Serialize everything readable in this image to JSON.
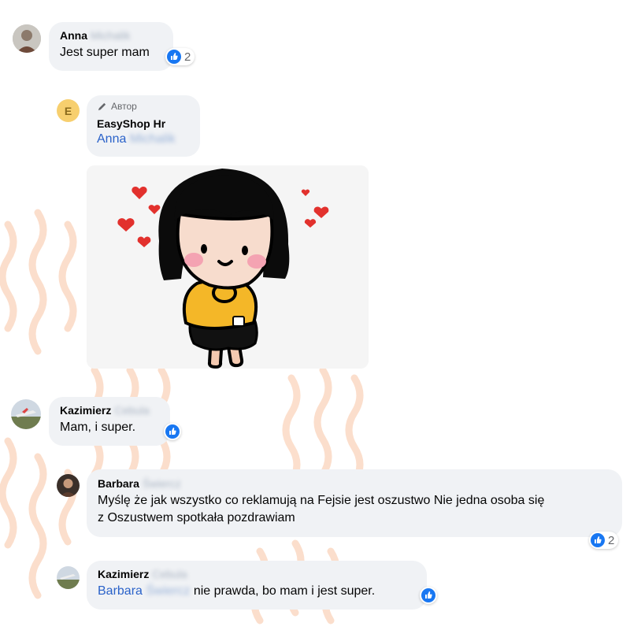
{
  "comments": [
    {
      "author_first": "Anna",
      "author_last_blurred": "Michalik",
      "text": "Jest super mam",
      "reaction_count": "2"
    },
    {
      "author_badge": "Автор",
      "avatar_letter": "E",
      "author": "EasyShop Hr",
      "mention_first": "Anna",
      "mention_last_blurred": "Michalik"
    },
    {
      "author_first": "Kazimierz",
      "author_last_blurred": "Cebula",
      "text": "Mam, i super."
    },
    {
      "author_first": "Barbara",
      "author_last_blurred": "Świercz",
      "text_line1": "Myślę że jak wszystko co reklamują na Fejsie jest oszustwo Nie jedna osoba się",
      "text_line2": "z Oszustwem spotkała pozdrawiam",
      "reaction_count": "2"
    },
    {
      "author_first": "Kazimierz",
      "author_last_blurred": "Cebula",
      "mention_first": "Barbara",
      "mention_last_blurred": "Świercz",
      "text": "nie prawda, bo mam i jest super."
    }
  ],
  "icons": {
    "reaction": "like-icon",
    "badge": "pencil-icon"
  },
  "colors": {
    "bubble": "#f0f2f5",
    "link": "#2a62c9",
    "like": "#1877f2",
    "badge_avatar": "#f7cf6e"
  }
}
